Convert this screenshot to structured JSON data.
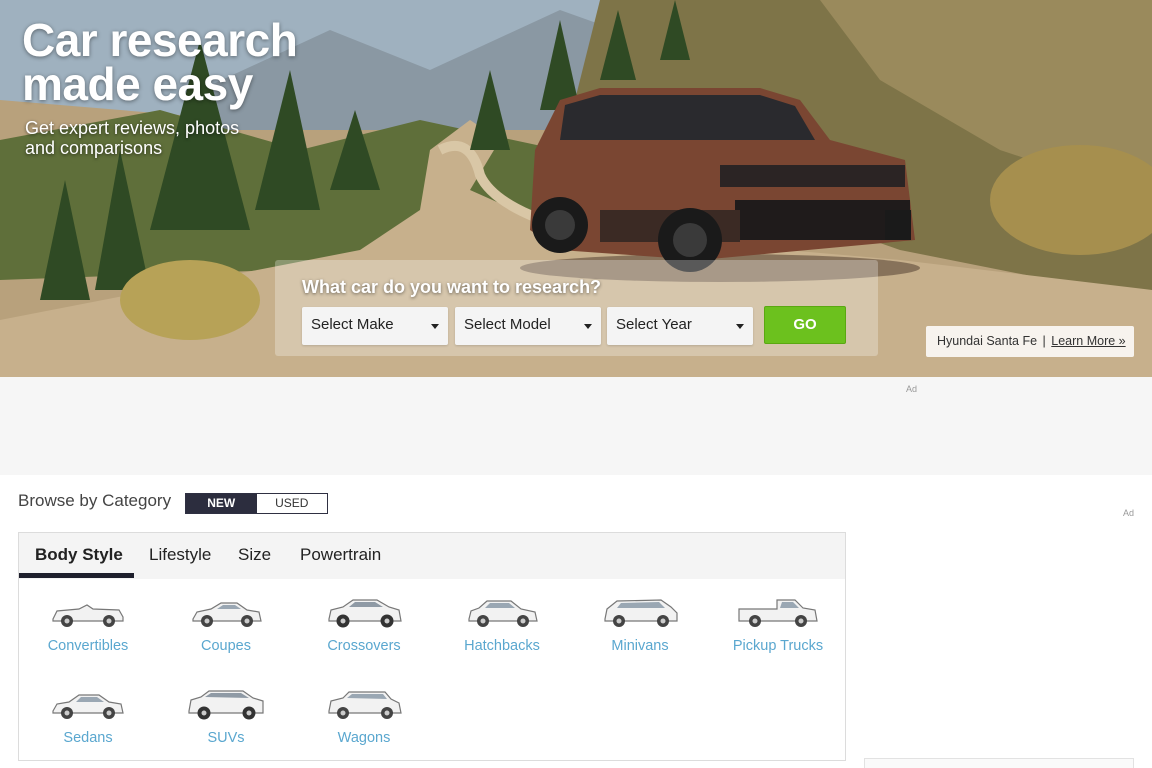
{
  "hero": {
    "title_line1": "Car research",
    "title_line2": "made easy",
    "subtitle_line1": "Get expert reviews, photos",
    "subtitle_line2": "and comparisons"
  },
  "search": {
    "question": "What car do you want to research?",
    "make_selected": "Select Make",
    "model_selected": "Select Model",
    "year_selected": "Select Year",
    "go_label": "GO"
  },
  "promo": {
    "vehicle": "Hyundai Santa Fe",
    "separator": "|",
    "link": "Learn More »"
  },
  "ads": {
    "top_label": "Ad",
    "side_label": "Ad"
  },
  "browse": {
    "title": "Browse by Category",
    "toggle_new": "NEW",
    "toggle_used": "USED",
    "tabs": [
      "Body Style",
      "Lifestyle",
      "Size",
      "Powertrain"
    ],
    "active_tab": "Body Style",
    "categories": [
      "Convertibles",
      "Coupes",
      "Crossovers",
      "Hatchbacks",
      "Minivans",
      "Pickup Trucks",
      "Sedans",
      "SUVs",
      "Wagons"
    ]
  },
  "colors": {
    "go_green": "#6cc11e",
    "link_blue": "#5aa7cf",
    "toggle_dark": "#2c2d3e"
  }
}
